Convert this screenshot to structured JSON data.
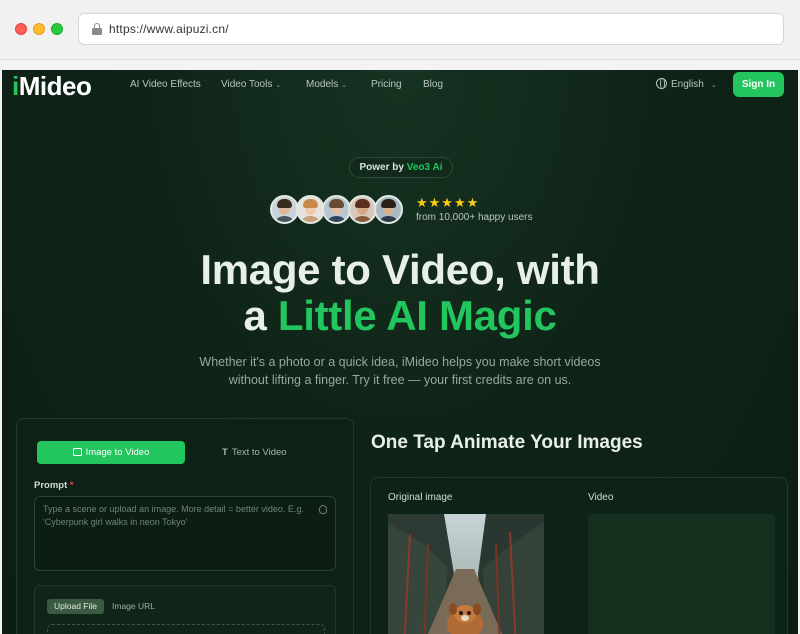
{
  "browser": {
    "url": "https://www.aipuzi.cn/"
  },
  "nav": {
    "logo_i": "i",
    "logo_rest": "Mideo",
    "items": [
      {
        "label": "AI Video Effects",
        "has_dropdown": false
      },
      {
        "label": "Video Tools",
        "has_dropdown": true
      },
      {
        "label": "Models",
        "has_dropdown": true
      },
      {
        "label": "Pricing",
        "has_dropdown": false
      },
      {
        "label": "Blog",
        "has_dropdown": false
      }
    ],
    "language": "English",
    "sign_in": "Sign In"
  },
  "hero": {
    "power_prefix": "Power by",
    "power_brand": "Veo3 Ai",
    "stars": "★★★★★",
    "happy_users": "from 10,000+ happy users",
    "title_line1": "Image to Video, with",
    "title_line2_prefix": "a",
    "title_line2_highlight": "Little AI Magic",
    "subtitle_line1": "Whether it's a photo or a quick idea, iMideo helps you make short videos",
    "subtitle_line2": "without lifting a finger. Try it free — your first credits are on us."
  },
  "generator": {
    "tabs": [
      {
        "label": "Image to Video",
        "active": true
      },
      {
        "label": "Text to Video",
        "active": false
      }
    ],
    "prompt_label": "Prompt",
    "prompt_required_mark": "*",
    "prompt_placeholder": "Type a scene or upload an image. More detail = better video. E.g. 'Cyberpunk girl walks in neon Tokyo'",
    "upload_file": "Upload File",
    "image_url": "Image URL"
  },
  "showcase": {
    "title": "One Tap Animate Your Images",
    "original_label": "Original image",
    "video_label": "Video"
  },
  "colors": {
    "accent": "#22c55e",
    "background": "#0f2418",
    "star": "#facc15",
    "required": "#ef4444"
  }
}
